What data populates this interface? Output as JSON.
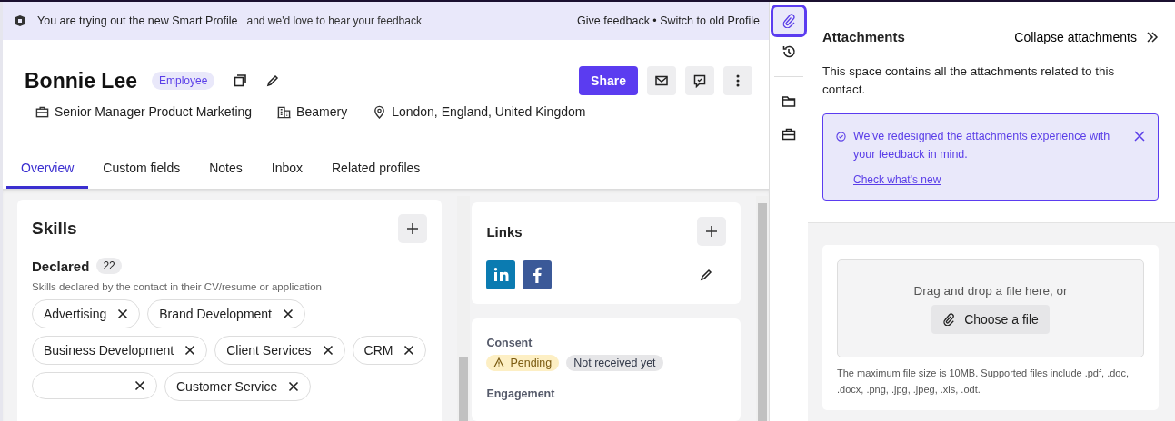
{
  "banner": {
    "message": "You are trying out the new Smart Profile",
    "sub": "and we'd love to hear your feedback",
    "actions": "Give feedback • Switch to old Profile"
  },
  "profile": {
    "name": "Bonnie Lee",
    "badge": "Employee",
    "share": "Share",
    "details": [
      {
        "kind": "job",
        "text": "Senior Manager Product Marketing"
      },
      {
        "kind": "company",
        "text": "Beamery"
      },
      {
        "kind": "location",
        "text": "London, England, United Kingdom"
      }
    ]
  },
  "tabs": [
    {
      "label": "Overview",
      "selected": true
    },
    {
      "label": "Custom fields",
      "selected": false
    },
    {
      "label": "Notes",
      "selected": false
    },
    {
      "label": "Inbox",
      "selected": false
    },
    {
      "label": "Related profiles",
      "selected": false
    }
  ],
  "skills": {
    "title": "Skills",
    "section": "Declared",
    "count": "22",
    "hint": "Skills declared by the contact in their CV/resume or application",
    "items": [
      {
        "kind": "skill",
        "label": "Advertising"
      },
      {
        "kind": "skill",
        "label": "Brand Development"
      },
      {
        "kind": "skill",
        "label": "Business Development"
      },
      {
        "kind": "skill",
        "label": "Client Services"
      },
      {
        "kind": "skill",
        "label": "CRM"
      },
      {
        "kind": "obscured"
      },
      {
        "kind": "skill",
        "label": "Customer Service"
      }
    ]
  },
  "links": {
    "title": "Links",
    "items": [
      {
        "kind": "linkedin"
      },
      {
        "kind": "facebook"
      }
    ]
  },
  "consent": {
    "label": "Consent",
    "tags": [
      {
        "kind": "warning",
        "text": "Pending"
      },
      {
        "kind": "neutral",
        "text": "Not received yet"
      }
    ],
    "engagement_label": "Engagement"
  },
  "rail": [
    {
      "kind": "attachment",
      "selected": true
    },
    {
      "kind": "history",
      "selected": false
    },
    {
      "kind": "divider"
    },
    {
      "kind": "folder",
      "selected": false
    },
    {
      "kind": "briefcase",
      "selected": false
    }
  ],
  "attachments": {
    "title": "Attachments",
    "collapse": "Collapse attachments",
    "intro": "This space contains all the attachments related to this contact.",
    "notice": {
      "text": "We've redesigned the attachments experience with your feedback in mind.",
      "link": "Check what's new"
    },
    "drop": {
      "text": "Drag and drop a file here, or",
      "button": "Choose a file"
    },
    "limits": "The maximum file size is 10MB. Supported files include .pdf, .doc, .docx, .png, .jpg, .jpeg, .xls, .odt."
  }
}
